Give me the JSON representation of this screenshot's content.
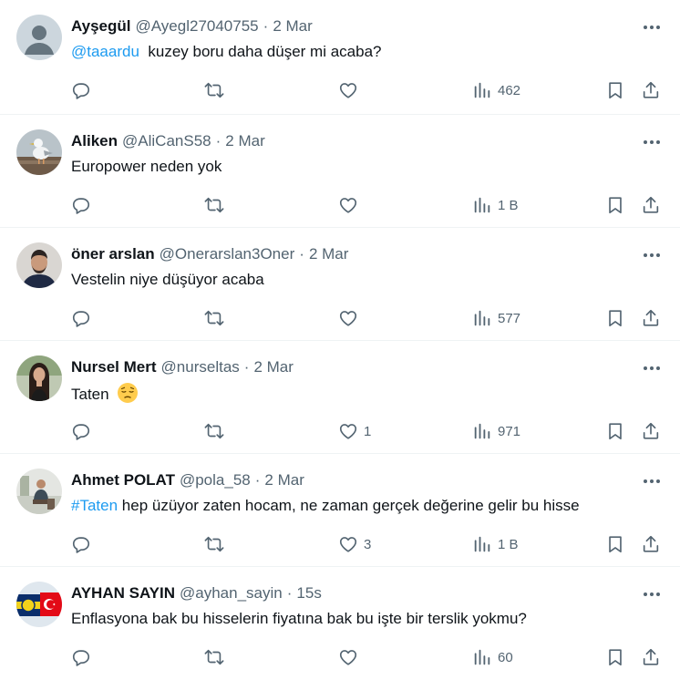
{
  "tweets": [
    {
      "name": "Ayşegül",
      "handle": "@Ayegl27040755",
      "time": "2 Mar",
      "mention": "@taaardu",
      "text": "kuzey boru daha düşer mi acaba?",
      "likes": "",
      "views": "462",
      "avatar": "default-avatar"
    },
    {
      "name": "Aliken",
      "handle": "@AliCanS58",
      "time": "2 Mar",
      "text": "Europower neden yok",
      "likes": "",
      "views": "1 B",
      "avatar": "seagull-photo-avatar"
    },
    {
      "name": "öner arslan",
      "handle": "@Onerarslan3Oner",
      "time": "2 Mar",
      "text": "Vestelin niye düşüyor acaba",
      "likes": "",
      "views": "577",
      "avatar": "man-photo-avatar"
    },
    {
      "name": "Nursel Mert",
      "handle": "@nurseltas",
      "time": "2 Mar",
      "text": "Taten",
      "emoji": "pensive-face-emoji",
      "likes": "1",
      "views": "971",
      "avatar": "woman-photo-avatar"
    },
    {
      "name": "Ahmet POLAT",
      "handle": "@pola_58",
      "time": "2 Mar",
      "hashtag": "#Taten",
      "text": "hep üzüyor zaten hocam, ne zaman gerçek değerine gelir bu hisse",
      "likes": "3",
      "views": "1 B",
      "avatar": "seated-man-photo-avatar"
    },
    {
      "name": "AYHAN SAYIN",
      "handle": "@ayhan_sayin",
      "time": "15s",
      "text": "Enflasyona bak bu hisselerin fiyatına bak bu işte bir terslik yokmu?",
      "likes": "",
      "views": "60",
      "avatar": "flag-avatar"
    }
  ],
  "colors": {
    "text": "#0f1419",
    "secondary": "#536471",
    "link": "#1d9bf0",
    "divider": "#eff3f4"
  },
  "icons": [
    "more-icon",
    "reply-icon",
    "retweet-icon",
    "like-icon",
    "views-icon",
    "bookmark-icon",
    "share-icon"
  ]
}
